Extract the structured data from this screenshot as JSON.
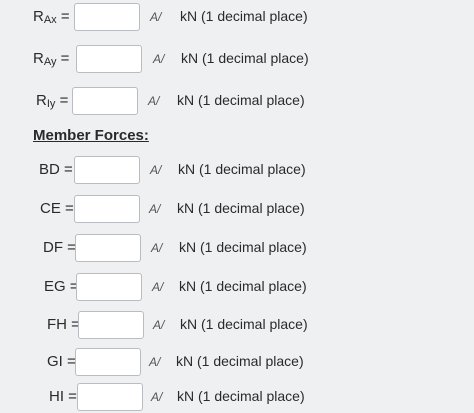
{
  "reactions": [
    {
      "base": "R",
      "sub": "Ax",
      "suffix": " =",
      "value": "",
      "unit": "kN (1 decimal place)"
    },
    {
      "base": "R",
      "sub": "Ay",
      "suffix": " =",
      "value": "",
      "unit": "kN (1 decimal place)"
    },
    {
      "base": "R",
      "sub": "Iy",
      "suffix": " =",
      "value": "",
      "unit": "kN (1 decimal place)"
    }
  ],
  "member_heading": "Member Forces:",
  "members": [
    {
      "label": "BD =",
      "value": "",
      "unit": "kN (1 decimal place)"
    },
    {
      "label": "CE =",
      "value": "",
      "unit": "kN (1 decimal place)"
    },
    {
      "label": "DF =",
      "value": "",
      "unit": "kN (1 decimal place)"
    },
    {
      "label": "EG =",
      "value": "",
      "unit": "kN (1 decimal place)"
    },
    {
      "label": "FH =",
      "value": "",
      "unit": "kN (1 decimal place)"
    },
    {
      "label": "GI =",
      "value": "",
      "unit": "kN (1 decimal place)"
    },
    {
      "label": "HI =",
      "value": "",
      "unit": "kN (1 decimal place)"
    }
  ],
  "spellcheck_icon": "A/"
}
